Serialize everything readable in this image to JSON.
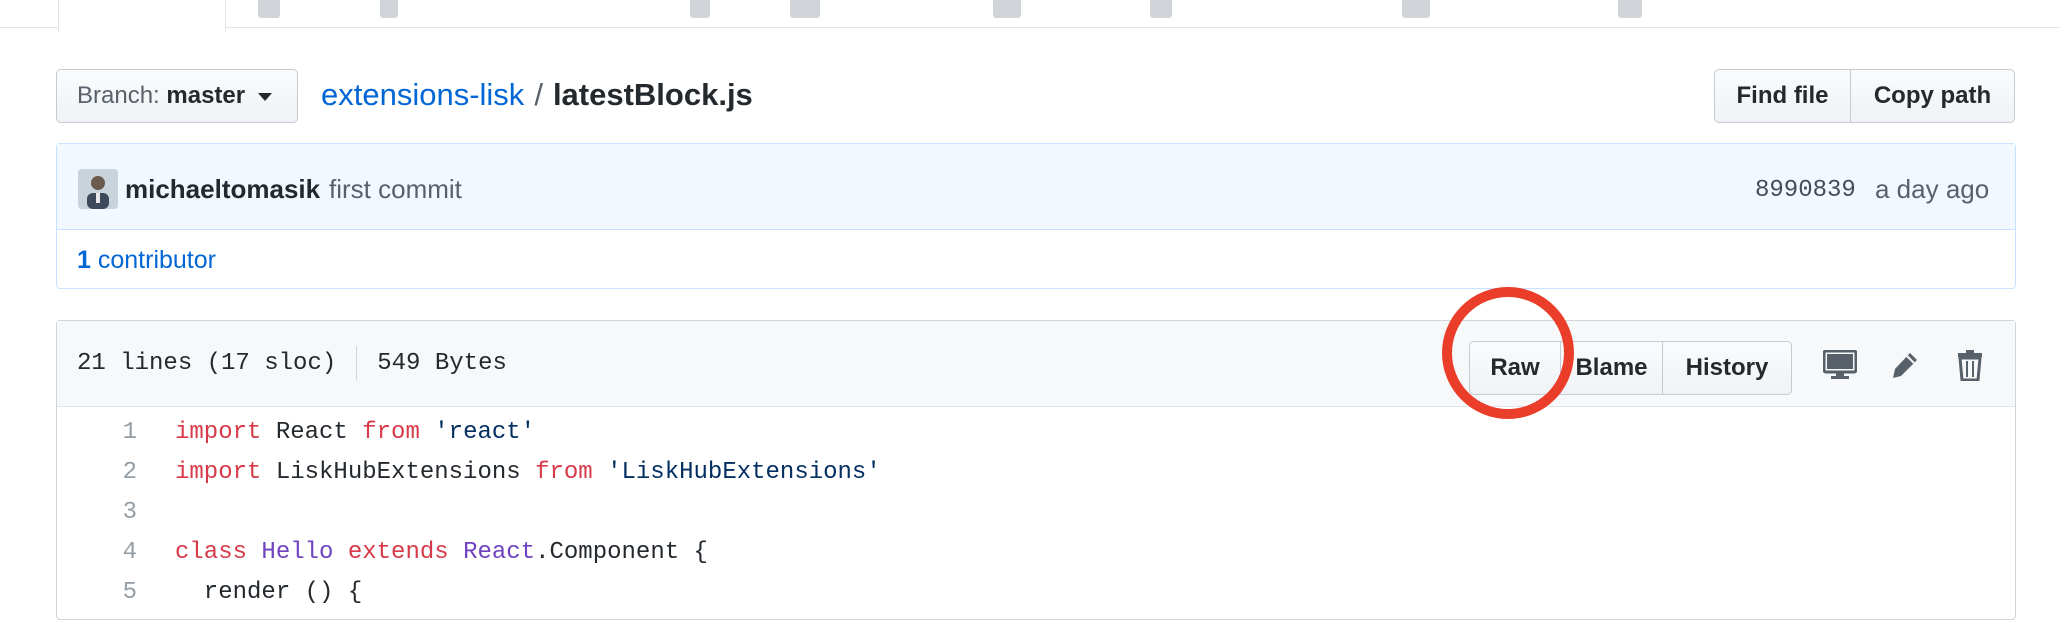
{
  "branch": {
    "label": "Branch:",
    "value": "master"
  },
  "breadcrumb": {
    "repo": "extensions-lisk",
    "separator": "/",
    "file": "latestBlock.js"
  },
  "file_nav": {
    "find_file": "Find file",
    "copy_path": "Copy path"
  },
  "commit": {
    "author": "michaeltomasik",
    "message": "first commit",
    "sha": "8990839",
    "time": "a day ago",
    "contributors_count": "1",
    "contributors_label": "contributor"
  },
  "file_header": {
    "lines": "21 lines (17 sloc)",
    "size": "549 Bytes",
    "raw": "Raw",
    "blame": "Blame",
    "history": "History"
  },
  "icons": {
    "desktop": "desktop-icon",
    "edit": "pencil-icon",
    "delete": "trash-icon",
    "avatar": "avatar-icon"
  },
  "colors": {
    "link": "#0366d6",
    "keyword": "#d73a49",
    "string": "#032f62",
    "class": "#6f42c1",
    "highlight_circle": "#ea3d2a"
  },
  "code_lines": [
    {
      "num": "1",
      "tokens": [
        {
          "t": "import",
          "c": "kw"
        },
        {
          "t": " React ",
          "c": "plain"
        },
        {
          "t": "from",
          "c": "kw"
        },
        {
          "t": " ",
          "c": "plain"
        },
        {
          "t": "'react'",
          "c": "str"
        }
      ]
    },
    {
      "num": "2",
      "tokens": [
        {
          "t": "import",
          "c": "kw"
        },
        {
          "t": " LiskHubExtensions ",
          "c": "plain"
        },
        {
          "t": "from",
          "c": "kw"
        },
        {
          "t": " ",
          "c": "plain"
        },
        {
          "t": "'LiskHubExtensions'",
          "c": "str"
        }
      ]
    },
    {
      "num": "3",
      "tokens": []
    },
    {
      "num": "4",
      "tokens": [
        {
          "t": "class",
          "c": "kw"
        },
        {
          "t": " ",
          "c": "plain"
        },
        {
          "t": "Hello",
          "c": "cls"
        },
        {
          "t": " ",
          "c": "plain"
        },
        {
          "t": "extends",
          "c": "kw"
        },
        {
          "t": " ",
          "c": "plain"
        },
        {
          "t": "React",
          "c": "cls"
        },
        {
          "t": ".Component {",
          "c": "plain"
        }
      ]
    },
    {
      "num": "5",
      "tokens": [
        {
          "t": "  render () {",
          "c": "plain"
        }
      ]
    }
  ]
}
